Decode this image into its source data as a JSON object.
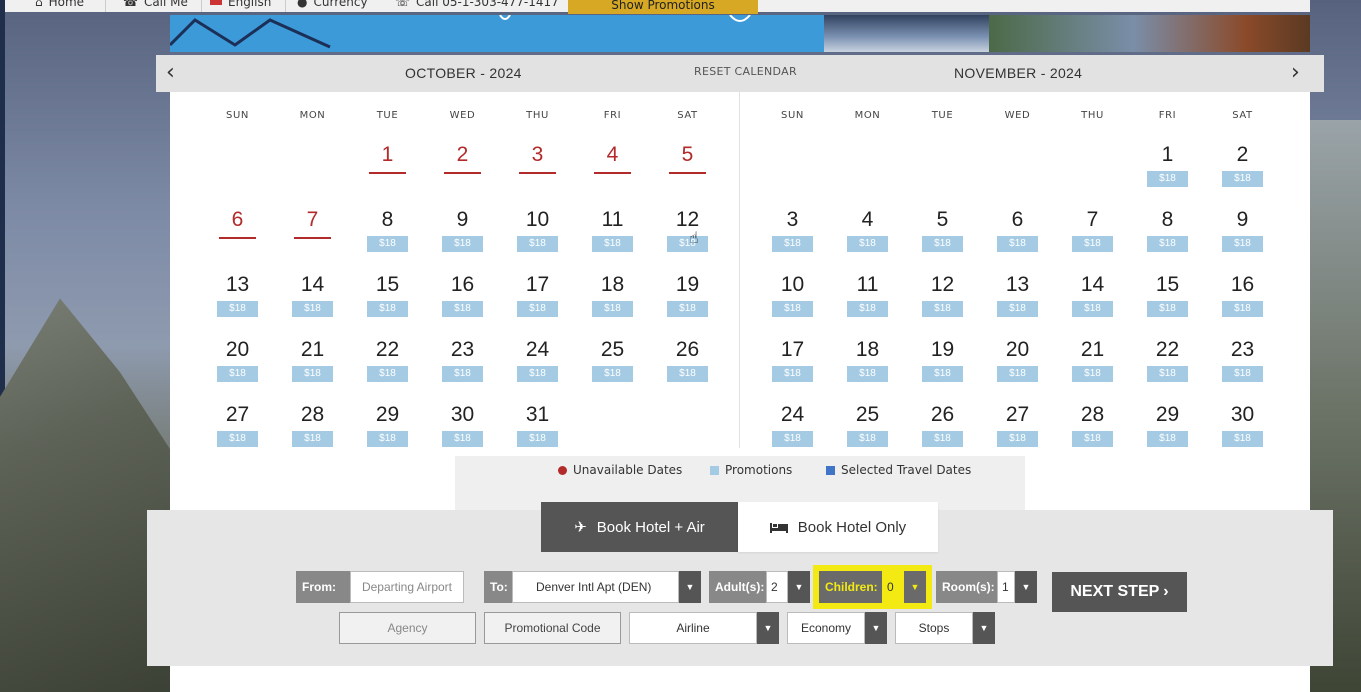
{
  "topnav": {
    "home": "Home",
    "call_me": "Call Me",
    "language": "English",
    "currency": "Currency",
    "phone": "Call 05-1-303-477-1417",
    "promotions": "Show Promotions"
  },
  "calendar": {
    "reset_label": "RESET CALENDAR",
    "weekdays": [
      "SUN",
      "MON",
      "TUE",
      "WED",
      "THU",
      "FRI",
      "SAT"
    ],
    "months": [
      {
        "title": "OCTOBER - 2024",
        "first_weekday": 2,
        "days": [
          {
            "d": "1",
            "status": "unavailable"
          },
          {
            "d": "2",
            "status": "unavailable"
          },
          {
            "d": "3",
            "status": "unavailable"
          },
          {
            "d": "4",
            "status": "unavailable"
          },
          {
            "d": "5",
            "status": "unavailable"
          },
          {
            "d": "6",
            "status": "unavailable"
          },
          {
            "d": "7",
            "status": "unavailable"
          },
          {
            "d": "8",
            "price": "$18"
          },
          {
            "d": "9",
            "price": "$18"
          },
          {
            "d": "10",
            "price": "$18"
          },
          {
            "d": "11",
            "price": "$18"
          },
          {
            "d": "12",
            "price": "$18"
          },
          {
            "d": "13",
            "price": "$18"
          },
          {
            "d": "14",
            "price": "$18"
          },
          {
            "d": "15",
            "price": "$18"
          },
          {
            "d": "16",
            "price": "$18"
          },
          {
            "d": "17",
            "price": "$18"
          },
          {
            "d": "18",
            "price": "$18"
          },
          {
            "d": "19",
            "price": "$18"
          },
          {
            "d": "20",
            "price": "$18"
          },
          {
            "d": "21",
            "price": "$18"
          },
          {
            "d": "22",
            "price": "$18"
          },
          {
            "d": "23",
            "price": "$18"
          },
          {
            "d": "24",
            "price": "$18"
          },
          {
            "d": "25",
            "price": "$18"
          },
          {
            "d": "26",
            "price": "$18"
          },
          {
            "d": "27",
            "price": "$18"
          },
          {
            "d": "28",
            "price": "$18"
          },
          {
            "d": "29",
            "price": "$18"
          },
          {
            "d": "30",
            "price": "$18"
          },
          {
            "d": "31",
            "price": "$18"
          }
        ]
      },
      {
        "title": "NOVEMBER - 2024",
        "first_weekday": 5,
        "days": [
          {
            "d": "1",
            "price": "$18"
          },
          {
            "d": "2",
            "price": "$18"
          },
          {
            "d": "3",
            "price": "$18"
          },
          {
            "d": "4",
            "price": "$18"
          },
          {
            "d": "5",
            "price": "$18"
          },
          {
            "d": "6",
            "price": "$18"
          },
          {
            "d": "7",
            "price": "$18"
          },
          {
            "d": "8",
            "price": "$18"
          },
          {
            "d": "9",
            "price": "$18"
          },
          {
            "d": "10",
            "price": "$18"
          },
          {
            "d": "11",
            "price": "$18"
          },
          {
            "d": "12",
            "price": "$18"
          },
          {
            "d": "13",
            "price": "$18"
          },
          {
            "d": "14",
            "price": "$18"
          },
          {
            "d": "15",
            "price": "$18"
          },
          {
            "d": "16",
            "price": "$18"
          },
          {
            "d": "17",
            "price": "$18"
          },
          {
            "d": "18",
            "price": "$18"
          },
          {
            "d": "19",
            "price": "$18"
          },
          {
            "d": "20",
            "price": "$18"
          },
          {
            "d": "21",
            "price": "$18"
          },
          {
            "d": "22",
            "price": "$18"
          },
          {
            "d": "23",
            "price": "$18"
          },
          {
            "d": "24",
            "price": "$18"
          },
          {
            "d": "25",
            "price": "$18"
          },
          {
            "d": "26",
            "price": "$18"
          },
          {
            "d": "27",
            "price": "$18"
          },
          {
            "d": "28",
            "price": "$18"
          },
          {
            "d": "29",
            "price": "$18"
          },
          {
            "d": "30",
            "price": "$18"
          }
        ]
      }
    ]
  },
  "legend": {
    "unavailable": "Unavailable Dates",
    "promotions": "Promotions",
    "selected": "Selected Travel Dates",
    "colors": {
      "unavailable": "#b22a2a",
      "promotions": "#a4cbe3",
      "selected": "#3f74c6"
    }
  },
  "booking": {
    "tab_air": "Book Hotel + Air",
    "tab_hotel": "Book Hotel Only",
    "from_label": "From:",
    "from_placeholder": "Departing Airport",
    "to_label": "To:",
    "to_value": "Denver Intl Apt (DEN)",
    "adults_label": "Adult(s):",
    "adults_value": "2",
    "children_label": "Children:",
    "children_value": "0",
    "rooms_label": "Room(s):",
    "rooms_value": "1",
    "next_step": "NEXT STEP",
    "agency": "Agency",
    "promo_code": "Promotional Code",
    "airline": "Airline",
    "cabin": "Economy",
    "stops": "Stops"
  },
  "colors": {
    "highlight": "#f3ea13",
    "dark_button": "#555555",
    "promo_gold": "#d7a823"
  }
}
